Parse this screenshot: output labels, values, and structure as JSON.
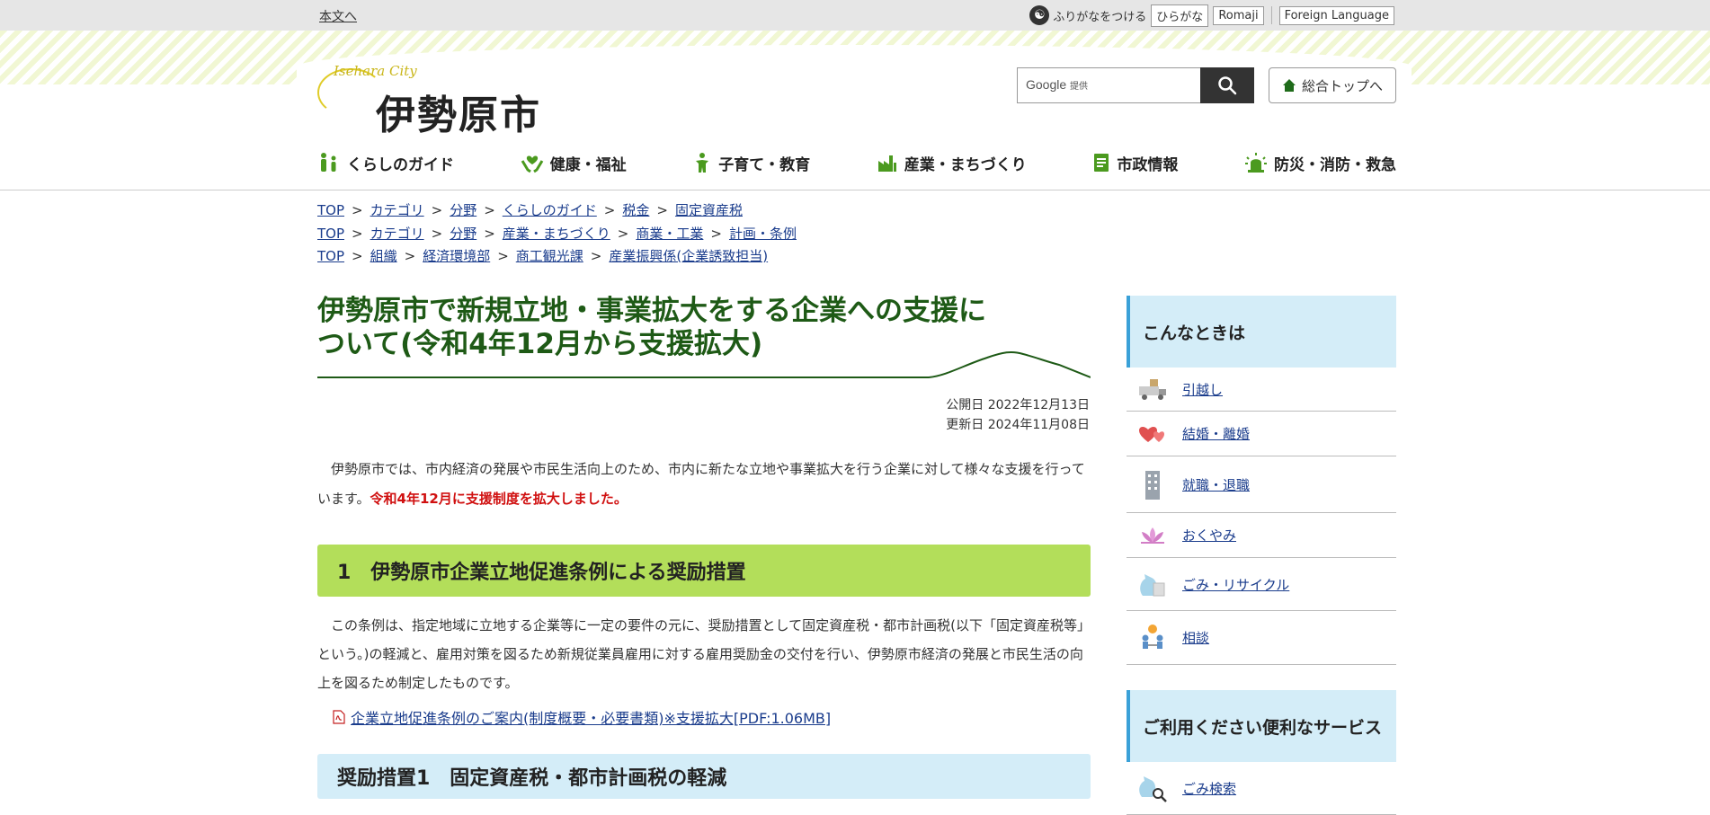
{
  "utility": {
    "skip_link": "本文へ",
    "furigana_label": "ふりがなをつける",
    "hiragana_label": "ひらがな",
    "romaji_label": "Romaji",
    "foreign_label": "Foreign Language"
  },
  "header": {
    "logo_script": "Isehara City",
    "logo_text": "伊勢原市",
    "search_brand": "Google",
    "search_brand_suffix": "提供",
    "home_label": "総合トップへ"
  },
  "nav": [
    {
      "label": "くらしのガイド",
      "icon": "family-icon"
    },
    {
      "label": "健康・福祉",
      "icon": "heart-hands-icon"
    },
    {
      "label": "子育て・教育",
      "icon": "child-icon"
    },
    {
      "label": "産業・まちづくり",
      "icon": "factory-icon"
    },
    {
      "label": "市政情報",
      "icon": "document-icon"
    },
    {
      "label": "防災・消防・救急",
      "icon": "alarm-light-icon"
    }
  ],
  "breadcrumbs": [
    [
      "TOP",
      "カテゴリ",
      "分野",
      "くらしのガイド",
      "税金",
      "固定資産税"
    ],
    [
      "TOP",
      "カテゴリ",
      "分野",
      "産業・まちづくり",
      "商業・工業",
      "計画・条例"
    ],
    [
      "TOP",
      "組織",
      "経済環境部",
      "商工観光課",
      "産業振興係(企業誘致担当)"
    ]
  ],
  "breadcrumb_separator": ">",
  "article": {
    "title": "伊勢原市で新規立地・事業拡大をする企業への支援について(令和4年12月から支援拡大)",
    "published": "公開日 2022年12月13日",
    "updated": "更新日 2024年11月08日",
    "intro": "伊勢原市では、市内経済の発展や市民生活向上のため、市内に新たな立地や事業拡大を行う企業に対して様々な支援を行っています。",
    "intro_highlight": "令和4年12月に支援制度を拡大しました。",
    "section1_heading": "1　伊勢原市企業立地促進条例による奨励措置",
    "section1_text": "この条例は、指定地域に立地する企業等に一定の要件の元に、奨励措置として固定資産税・都市計画税(以下「固定資産税等」という。)の軽減と、雇用対策を図るため新規従業員雇用に対する雇用奨励金の交付を行い、伊勢原市経済の発展と市民生活の向上を図るため制定したものです。",
    "pdf_link": "企業立地促進条例のご案内(制度概要・必要書類)※支援拡大[PDF:1.06MB]",
    "subsection_heading": "奨励措置1　固定資産税・都市計画税の軽減"
  },
  "sidebar": {
    "heading1": "こんなときは",
    "items": [
      {
        "label": "引越し",
        "icon": "moving-truck-icon"
      },
      {
        "label": "結婚・離婚",
        "icon": "hearts-icon"
      },
      {
        "label": "就職・退職",
        "icon": "office-building-icon"
      },
      {
        "label": "おくやみ",
        "icon": "lotus-icon"
      },
      {
        "label": "ごみ・リサイクル",
        "icon": "garbage-bag-icon"
      },
      {
        "label": "相談",
        "icon": "consultation-icon"
      }
    ],
    "heading2": "ご利用ください便利なサービス",
    "items2": [
      {
        "label": "ごみ検索",
        "icon": "garbage-search-icon"
      }
    ]
  },
  "colors": {
    "title_green": "#1e5a16",
    "section_green": "#b3de5a",
    "section_blue": "#d4edf8",
    "highlight_red": "#d01010",
    "link_blue": "#1a3c8c"
  }
}
